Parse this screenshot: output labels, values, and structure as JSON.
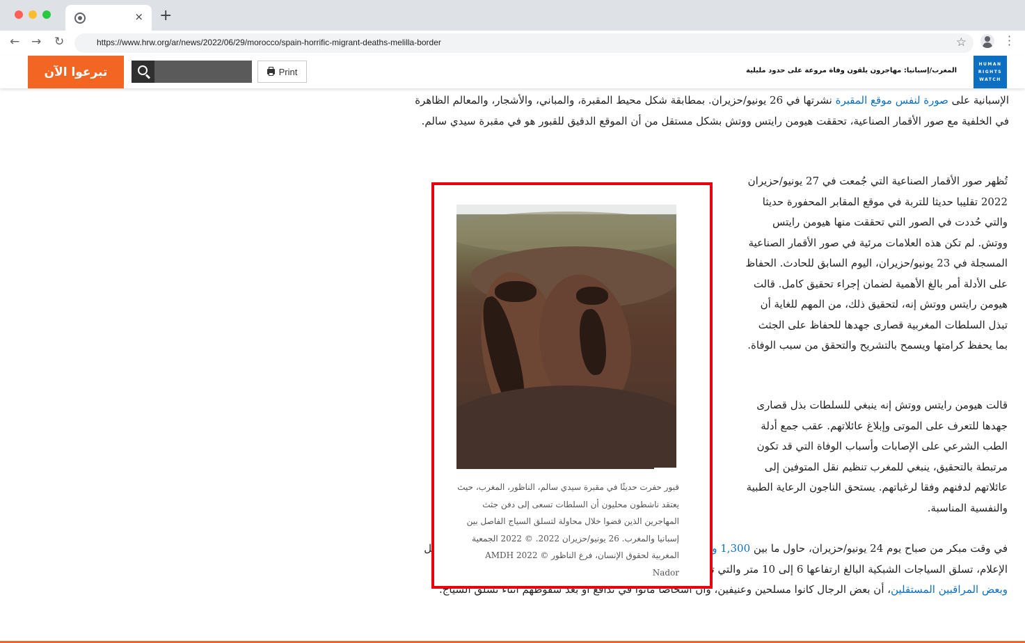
{
  "browser": {
    "url": "https://www.hrw.org/ar/news/2022/06/29/morocco/spain-horrific-migrant-deaths-melilla-border",
    "tab_close": "×",
    "new_tab": "+",
    "colors": {
      "close": "#ff5f57",
      "minimize": "#febc2e",
      "maximize": "#28c840"
    }
  },
  "header": {
    "donate_label": "تبرعوا الآن",
    "search_placeholder": "",
    "print_label": "Print",
    "breadcrumb": "المغرب/إسبانيا: مهاجرون يلقون وفاة مروعة على حدود مليلية",
    "logo_lines": [
      "HUMAN",
      "RIGHTS",
      "WATCH"
    ],
    "colors": {
      "donate": "#f26522",
      "logo": "#0c6fc1"
    }
  },
  "article": {
    "p_top": {
      "before_link": "الإسبانية على ",
      "link": "صورة لنفس موقع المقبرة",
      "after_link": " نشرتها في 26 يونيو/حزيران. بمطابقة شكل محيط المقبرة، والمباني، والأشجار، والمعالم الظاهرة في الخلفية مع صور الأقمار الصناعية، تحققت هيومن رايتس ووتش بشكل مستقل من أن الموقع الدقيق للقبور هو في مقبرة سيدي سالم."
    },
    "p1": "تُظهر صور الأقمار الصناعية التي جُمعت في 27 يونيو/حزيران 2022 تقليبا حديثا للتربة في موقع المقابر المحفورة حديثا والتي حُددت في الصور التي تحققت منها هيومن رايتس ووتش. لم تكن هذه العلامات مرئية في صور الأقمار الصناعية المسجلة في 23 يونيو/حزيران، اليوم السابق للحادث. الحفاظ على الأدلة أمر بالغ الأهمية لضمان إجراء تحقيق كامل. قالت هيومن رايتس ووتش إنه، لتحقيق ذلك، من المهم للغاية أن تبذل السلطات المغربية قصارى جهدها للحفاظ على الجثث بما يحفظ كرامتها ويسمح بالتشريح والتحقق من سبب الوفاة.",
    "p2": "قالت هيومن رايتس ووتش إنه ينبغي للسلطات بذل قصارى جهدها للتعرف على الموتى وإبلاغ عائلاتهم. عقب جمع أدلة الطب الشرعي على الإصابات وأسباب الوفاة التي قد تكون مرتبطة بالتحقيق، ينبغي للمغرب تنظيم نقل المتوفين إلى عائلاتهم لدفنهم وفقا لرغباتهم. يستحق الناجون الرعاية الطبية والنفسية المناسبة.",
    "p3": {
      "t1": "في وقت مبكر من صباح يوم 24 يونيو/حزيران، حاول ما بين ",
      "link1": "1,300 و 2,000 رجل",
      "t2": "، معظمهم من السودان وجنوب السودان، وفقا لوسائل الإعلام، تسلق السياجات الشبكية البالغ ارتفاعها 6 إلى 10 متر والتي تفصل بين الأراضي المغربية والإسبانية. تزعم ",
      "link2": "السلطات المغربية، وبعض المراقبين المستقلين",
      "t3": "، أن بعض الرجال كانوا مسلحين وعنيفين، وأن أشخاصا ماتوا في تدافع أو بعد سقوطهم أثناء تسلق السياج."
    },
    "figure": {
      "caption": "قبور حفرت حديثًا في مقبرة سيدي سالم، الناظور، المغرب، حيث يعتقد ناشطون محليون أن السلطات تسعى إلى دفن جثث المهاجرين الذين قضوا خلال محاولة لتسلق السياج الفاصل بين إسبانيا والمغرب. 26 يونيو/حزيران 2022. © 2022 الجمعية المغربية لحقوق الإنسان، فرع الناظور © AMDH 2022 Nador",
      "highlight_color": "#e8000f"
    },
    "link_color": "#0c6fc1"
  }
}
